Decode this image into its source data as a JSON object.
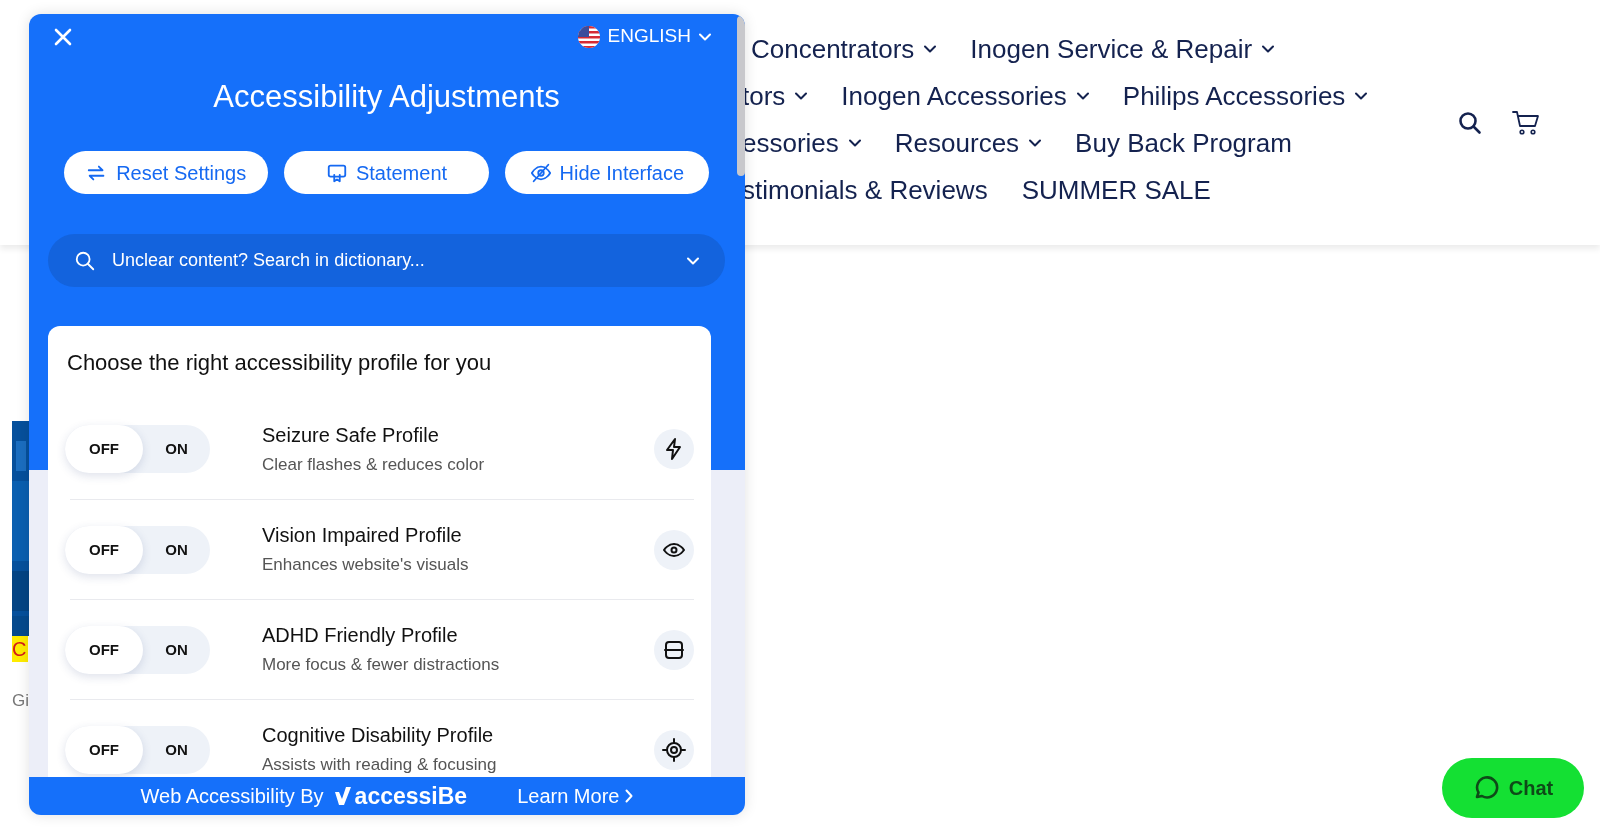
{
  "site_header": {
    "nav_rows": [
      [
        {
          "label": "Concentrators",
          "dropdown": true
        },
        {
          "label": "Inogen Service & Repair",
          "dropdown": true
        }
      ],
      [
        {
          "label": "tors",
          "dropdown": true
        },
        {
          "label": "Inogen Accessories",
          "dropdown": true
        },
        {
          "label": "Philips Accessories",
          "dropdown": true
        }
      ],
      [
        {
          "label": "essories",
          "dropdown": true
        },
        {
          "label": "Resources",
          "dropdown": true
        },
        {
          "label": "Buy Back Program",
          "dropdown": false
        }
      ],
      [
        {
          "label": "stimonials & Reviews",
          "dropdown": false
        },
        {
          "label": "SUMMER SALE",
          "dropdown": false
        }
      ]
    ]
  },
  "page_left": {
    "tag": "C",
    "text": "Gi"
  },
  "accessibility_panel": {
    "language": "ENGLISH",
    "title": "Accessibility Adjustments",
    "buttons": [
      {
        "label": "Reset Settings"
      },
      {
        "label": "Statement"
      },
      {
        "label": "Hide Interface"
      }
    ],
    "dictionary": {
      "placeholder": "Unclear content? Search in dictionary..."
    },
    "profiles_heading": "Choose the right accessibility profile for you",
    "profiles": [
      {
        "title": "Seizure Safe Profile",
        "subtitle": "Clear flashes & reduces color",
        "on": false,
        "off_label": "OFF",
        "on_label": "ON"
      },
      {
        "title": "Vision Impaired Profile",
        "subtitle": "Enhances website's visuals",
        "on": false,
        "off_label": "OFF",
        "on_label": "ON"
      },
      {
        "title": "ADHD Friendly Profile",
        "subtitle": "More focus & fewer distractions",
        "on": false,
        "off_label": "OFF",
        "on_label": "ON"
      },
      {
        "title": "Cognitive Disability Profile",
        "subtitle": "Assists with reading & focusing",
        "on": false,
        "off_label": "OFF",
        "on_label": "ON"
      }
    ],
    "footer": {
      "credit": "Web Accessibility By",
      "brand": "accessiBe",
      "link": "Learn More"
    }
  },
  "chat": {
    "label": "Chat"
  }
}
